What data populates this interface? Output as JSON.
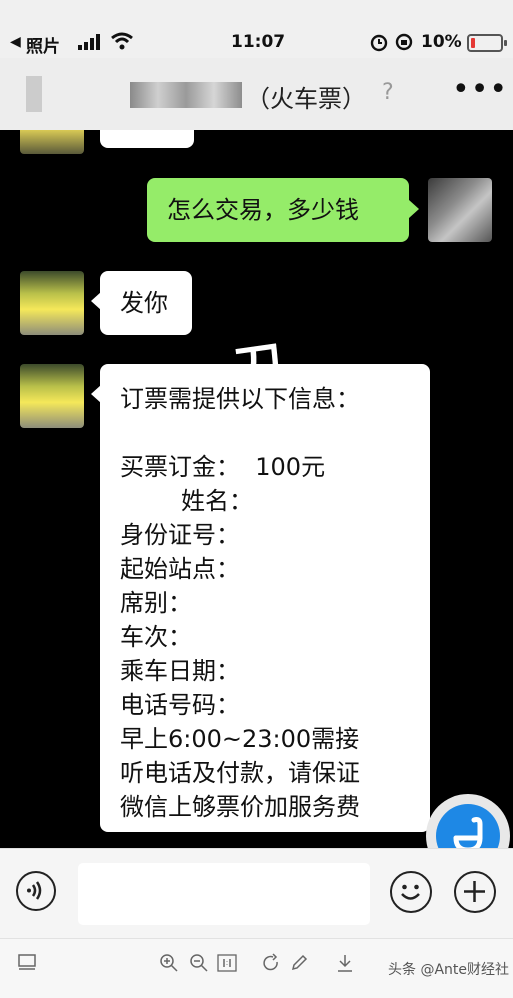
{
  "status_bar": {
    "back_label": "照片",
    "time": "11:07",
    "battery": "10%"
  },
  "header": {
    "title_suffix": "（火车票）"
  },
  "messages": [
    {
      "side": "right",
      "text": "怎么交易，多少钱"
    },
    {
      "side": "left",
      "text": "发你"
    },
    {
      "side": "left",
      "lines": [
        "订票需提供以下信息：",
        "",
        "买票订金：  100元",
        "        姓名：",
        "身份证号：",
        "起始站点：",
        "席别：",
        "车次：",
        "乘车日期：",
        "电话号码：",
        "早上6:00~23:00需接",
        "听电话及付款，请保证",
        "微信上够票价加服务费"
      ]
    }
  ],
  "background_glyph": "刀",
  "watermark": "头条 @Ante财经社",
  "colors": {
    "chat_bg": "#000000",
    "green_bubble": "#95ec69",
    "floating_button": "#1e88e5",
    "battery_low": "#e53935"
  },
  "icons": [
    "back-arrow-icon",
    "signal-icon",
    "wifi-icon",
    "alarm-icon",
    "rotation-lock-icon",
    "battery-icon",
    "ear-icon",
    "more-icon",
    "voice-icon",
    "emoji-icon",
    "plus-icon",
    "floating-assistant-icon",
    "sidebar-icon",
    "zoom-in-icon",
    "zoom-out-icon",
    "actual-size-icon",
    "rotate-icon",
    "edit-icon",
    "download-icon"
  ]
}
